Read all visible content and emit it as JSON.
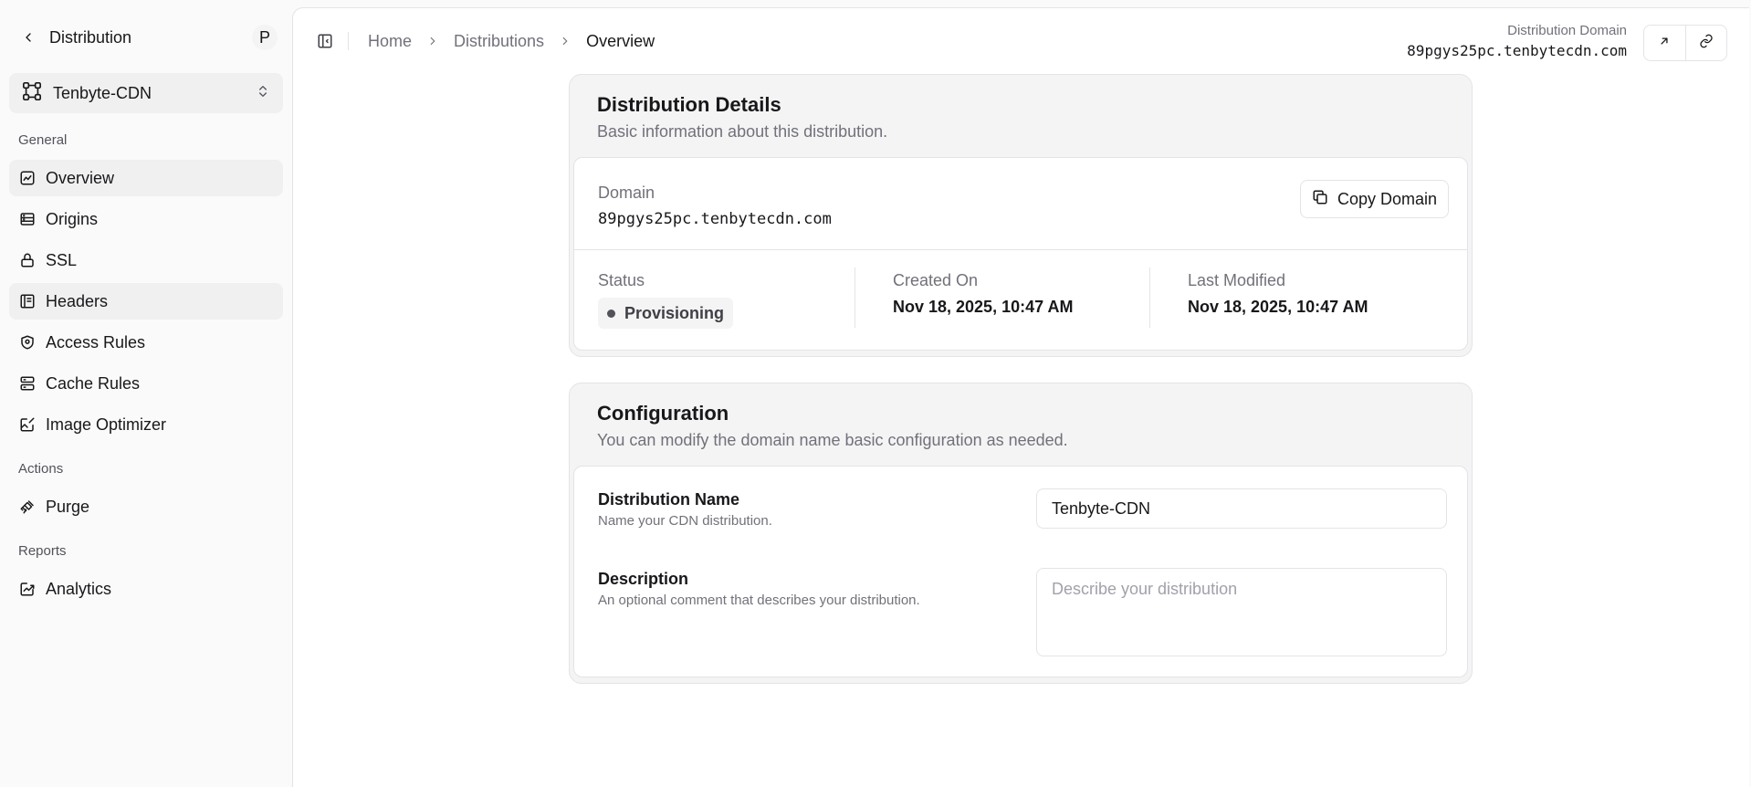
{
  "sidebar": {
    "title": "Distribution",
    "avatar_initial": "P",
    "switcher": {
      "label": "Tenbyte-CDN"
    },
    "groups": {
      "general": "General",
      "actions": "Actions",
      "reports": "Reports"
    },
    "items": {
      "overview": "Overview",
      "origins": "Origins",
      "ssl": "SSL",
      "headers": "Headers",
      "access_rules": "Access Rules",
      "cache_rules": "Cache Rules",
      "image_optimizer": "Image Optimizer",
      "purge": "Purge",
      "analytics": "Analytics"
    }
  },
  "header": {
    "breadcrumb": [
      "Home",
      "Distributions",
      "Overview"
    ],
    "distribution_domain_label": "Distribution Domain",
    "distribution_domain": "89pgys25pc.tenbytecdn.com"
  },
  "details": {
    "title": "Distribution Details",
    "description": "Basic information about this distribution.",
    "domain_label": "Domain",
    "domain_value": "89pgys25pc.tenbytecdn.com",
    "copy_button": "Copy Domain",
    "status_label": "Status",
    "status_value": "Provisioning",
    "created_label": "Created On",
    "created_value": "Nov 18, 2025, 10:47 AM",
    "modified_label": "Last Modified",
    "modified_value": "Nov 18, 2025, 10:47 AM"
  },
  "configuration": {
    "title": "Configuration",
    "description": "You can modify the domain name basic configuration as needed.",
    "name_label": "Distribution Name",
    "name_hint": "Name your CDN distribution.",
    "name_value": "Tenbyte-CDN",
    "desc_label": "Description",
    "desc_hint": "An optional comment that describes your distribution.",
    "desc_placeholder": "Describe your distribution"
  },
  "colors": {
    "accent": "#18181b",
    "muted": "#71717a",
    "border": "#e4e4e7",
    "card_bg": "#f4f4f5"
  }
}
